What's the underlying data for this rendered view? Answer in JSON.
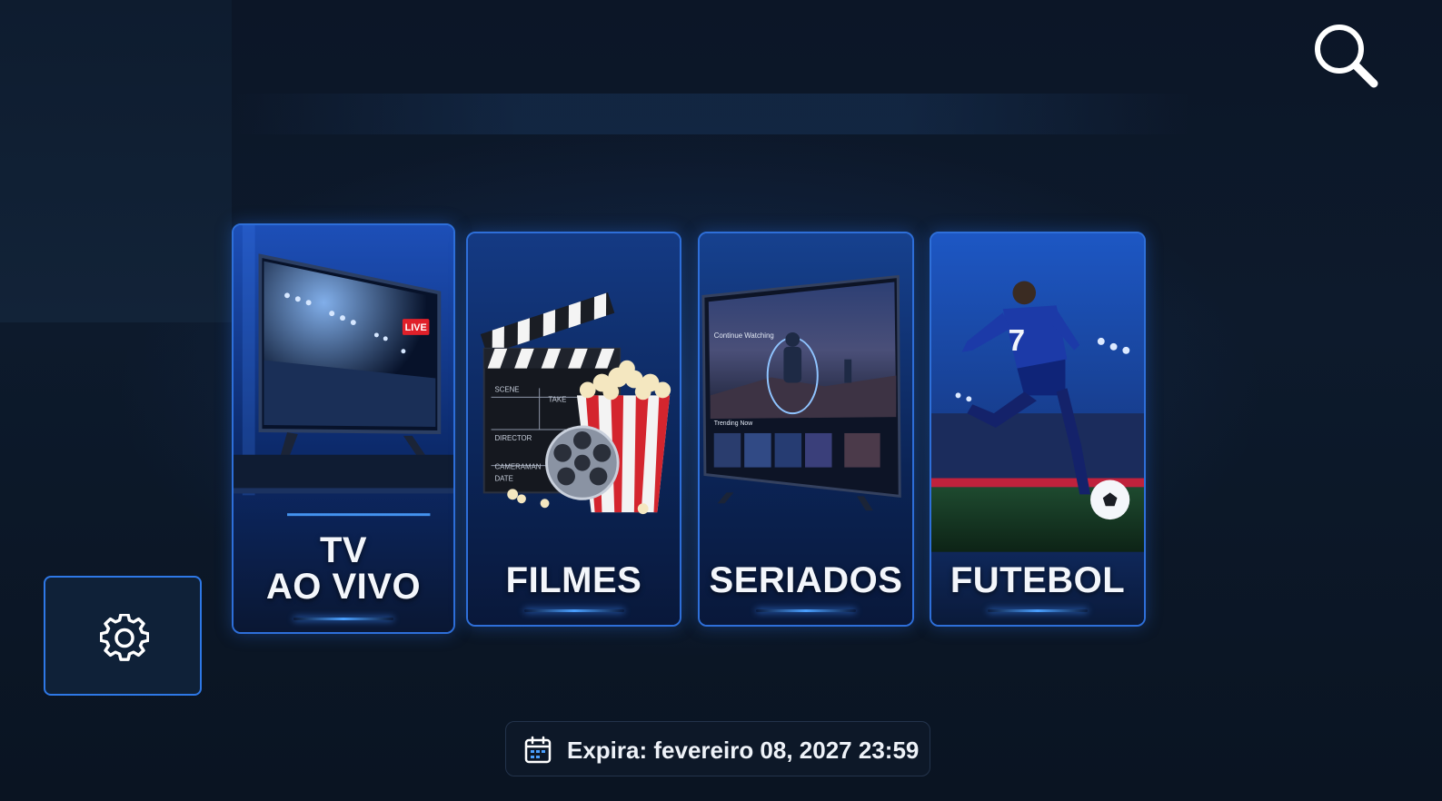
{
  "app": {
    "accent_color": "#2e6fd9",
    "background_color": "#0b1524"
  },
  "header": {
    "search_icon": "search-icon"
  },
  "categories": [
    {
      "label_line1": "TV",
      "label_line2": "AO VIVO",
      "badge": "LIVE"
    },
    {
      "label": "FILMES",
      "clapper_texts": [
        "SCENE",
        "TAKE",
        "DIRECTOR",
        "CAMERAMAN",
        "DATE"
      ]
    },
    {
      "label": "SERIADOS",
      "screen_texts": [
        "Continue Watching",
        "Trending Now"
      ]
    },
    {
      "label": "FUTEBOL",
      "jersey_number": "7"
    }
  ],
  "settings": {
    "icon": "gear-icon"
  },
  "footer": {
    "icon": "calendar-icon",
    "expiry_text": "Expira: fevereiro 08, 2027 23:59"
  }
}
